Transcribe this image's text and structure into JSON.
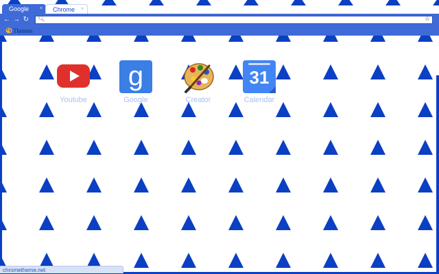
{
  "tabs": [
    {
      "label": "Google",
      "active": true
    },
    {
      "label": "Chrome",
      "active": false
    }
  ],
  "tab_close_glyph": "×",
  "toolbar": {
    "back_icon": "back-arrow-icon",
    "forward_icon": "forward-arrow-icon",
    "reload_icon": "reload-icon",
    "omnibox_value": "",
    "search_icon": "search-icon",
    "bookmark_star_icon": "star-icon"
  },
  "bookmarks_bar": {
    "items": [
      {
        "label": "Themes",
        "icon": "themes-palette-icon"
      }
    ]
  },
  "apps": [
    {
      "label": "Youtube",
      "icon": "youtube-icon"
    },
    {
      "label": "Google",
      "icon": "google-icon",
      "glyph": "g"
    },
    {
      "label": "Creator",
      "icon": "palette-icon"
    },
    {
      "label": "Calendar",
      "icon": "calendar-icon",
      "glyph": "31"
    }
  ],
  "status_bar": {
    "text": "chrometheme.net"
  },
  "colors": {
    "theme_blue": "#0b3fc4",
    "toolbar_blue": "#3f6bd8",
    "app_label": "#a9bff0",
    "background": "#ffffff"
  }
}
